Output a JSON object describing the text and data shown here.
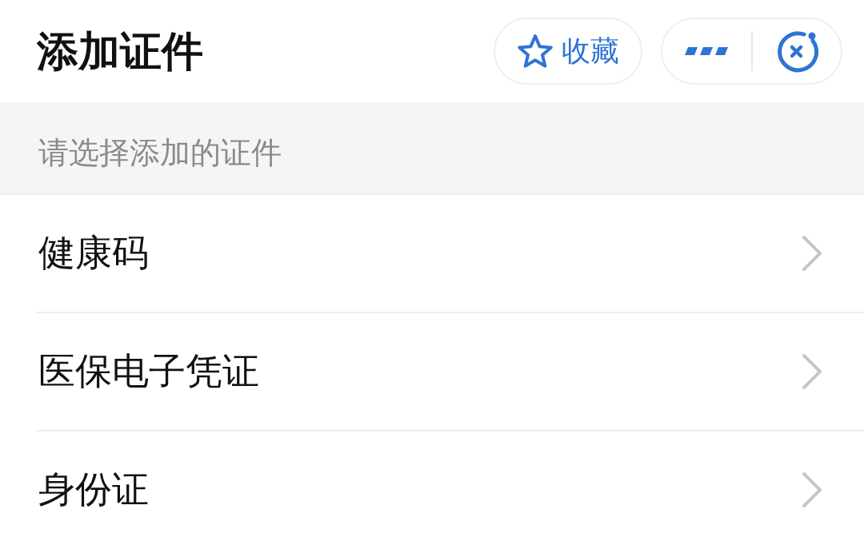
{
  "header": {
    "title": "添加证件",
    "favorite_button": {
      "label": "收藏"
    }
  },
  "section": {
    "hint": "请选择添加的证件"
  },
  "items": [
    {
      "label": "健康码"
    },
    {
      "label": "医保电子凭证"
    },
    {
      "label": "身份证"
    }
  ]
}
